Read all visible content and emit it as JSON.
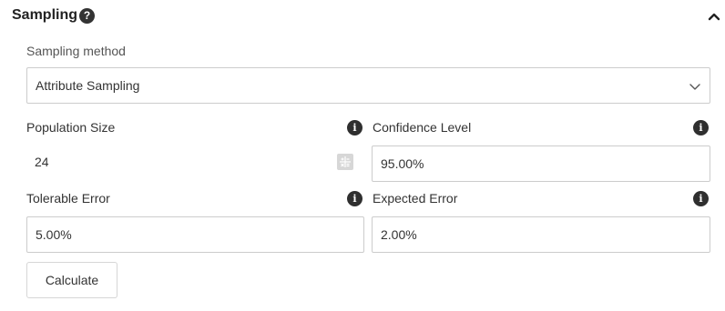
{
  "section": {
    "title": "Sampling",
    "help_icon": "question-circle-icon",
    "collapse_icon": "chevron-up-icon"
  },
  "sampling_method": {
    "label": "Sampling method",
    "value": "Attribute Sampling",
    "dropdown_icon": "chevron-down-icon"
  },
  "population_size": {
    "label": "Population Size",
    "value": "24",
    "info_icon": "info-icon",
    "calculator_icon": "calculator-icon"
  },
  "confidence_level": {
    "label": "Confidence Level",
    "value": "95.00%",
    "info_icon": "info-icon"
  },
  "tolerable_error": {
    "label": "Tolerable Error",
    "value": "5.00%",
    "info_icon": "info-icon"
  },
  "expected_error": {
    "label": "Expected Error",
    "value": "2.00%",
    "info_icon": "info-icon"
  },
  "actions": {
    "calculate_label": "Calculate"
  },
  "colors": {
    "text": "#333333",
    "border": "#cccccc",
    "icon_dark": "#2f2f2f",
    "icon_muted": "#d7d7d7"
  }
}
